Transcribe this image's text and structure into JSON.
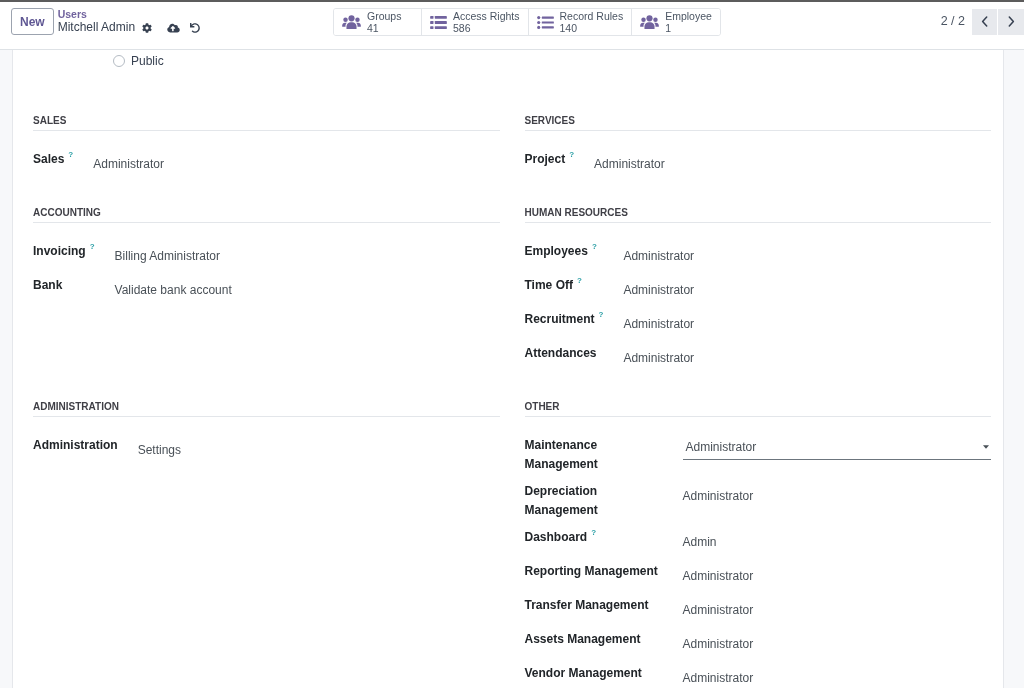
{
  "control_panel": {
    "new_button": "New",
    "breadcrumb": {
      "parent": "Users",
      "current": "Mitchell Admin"
    },
    "smart_buttons": [
      {
        "kind": "people",
        "label": "Groups",
        "count": "41"
      },
      {
        "kind": "list",
        "label": "Access Rights",
        "count": "586"
      },
      {
        "kind": "bullets",
        "label": "Record Rules",
        "count": "140"
      },
      {
        "kind": "people",
        "label": "Employee",
        "count": "1"
      }
    ],
    "pager": "2 / 2"
  },
  "user_type_options": [
    {
      "label": "Public",
      "selected": false
    }
  ],
  "sections": [
    {
      "title": "SALES",
      "fields": [
        {
          "kind": "text",
          "label": "Sales",
          "help": "?",
          "value": "Administrator"
        }
      ]
    },
    {
      "title": "SERVICES",
      "fields": [
        {
          "kind": "text",
          "label": "Project",
          "help": "?",
          "value": "Administrator"
        }
      ]
    },
    {
      "title": "ACCOUNTING",
      "fields": [
        {
          "kind": "text",
          "label": "Invoicing",
          "help": "?",
          "value": "Billing Administrator"
        },
        {
          "kind": "text",
          "label": "Bank",
          "value": "Validate bank account"
        }
      ]
    },
    {
      "title": "HUMAN RESOURCES",
      "fields": [
        {
          "kind": "text",
          "label": "Employees",
          "help": "?",
          "value": "Administrator"
        },
        {
          "kind": "text",
          "label": "Time Off",
          "help": "?",
          "value": "Administrator"
        },
        {
          "kind": "text",
          "label": "Recruitment",
          "help": "?",
          "value": "Administrator"
        },
        {
          "kind": "text",
          "label": "Attendances",
          "value": "Administrator"
        }
      ]
    },
    {
      "title": "ADMINISTRATION",
      "fields": [
        {
          "kind": "text",
          "label": "Administration",
          "value": "Settings"
        }
      ]
    },
    {
      "title": "OTHER",
      "fields": [
        {
          "kind": "select",
          "label": "Maintenance Management",
          "value": "Administrator"
        },
        {
          "kind": "text",
          "label": "Depreciation Management",
          "value": "Administrator"
        },
        {
          "kind": "text",
          "label": "Dashboard",
          "help": "?",
          "value": "Admin"
        },
        {
          "kind": "text",
          "label": "Reporting Management",
          "value": "Administrator"
        },
        {
          "kind": "text",
          "label": "Transfer Management",
          "value": "Administrator"
        },
        {
          "kind": "text",
          "label": "Assets Management",
          "value": "Administrator"
        },
        {
          "kind": "text",
          "label": "Vendor Management",
          "value": "Administrator"
        }
      ]
    }
  ]
}
